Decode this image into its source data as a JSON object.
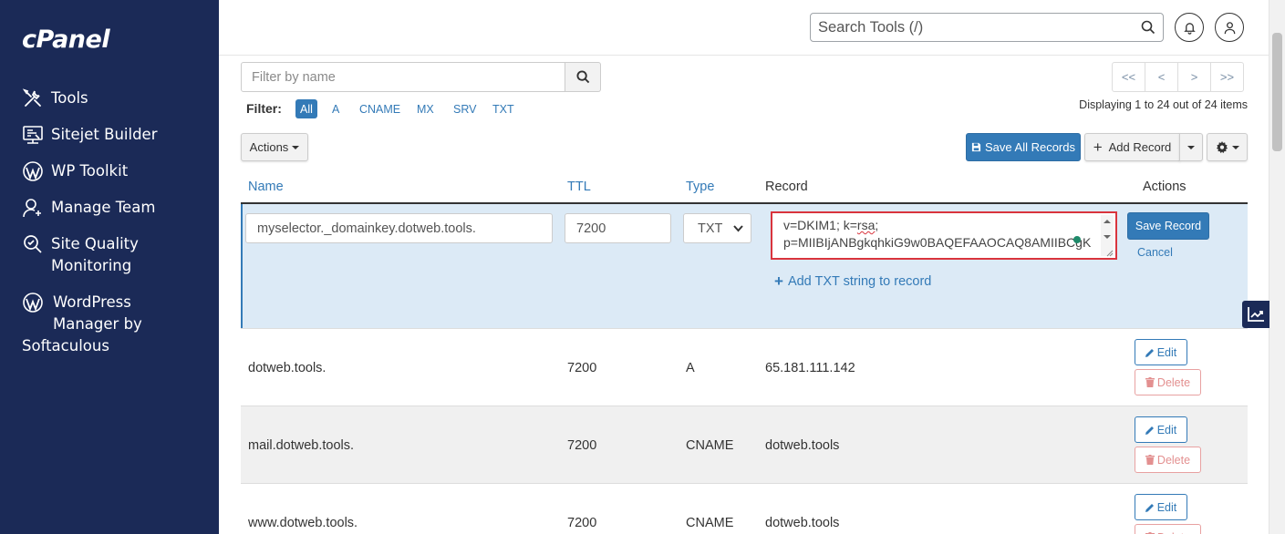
{
  "app": {
    "logo": "cPanel"
  },
  "sidebar": {
    "items": [
      {
        "label": "Tools",
        "icon": "tools-icon"
      },
      {
        "label": "Sitejet Builder",
        "icon": "sitejet-icon"
      },
      {
        "label": "WP Toolkit",
        "icon": "wordpress-icon"
      },
      {
        "label": "Manage Team",
        "icon": "user-plus-icon"
      },
      {
        "label_line1": "Site Quality",
        "label_line2": "Monitoring",
        "icon": "site-quality-icon"
      },
      {
        "label_line1": "WordPress",
        "label_line2": "Manager by",
        "label_line3": "Softaculous",
        "icon": "wordpress-icon"
      }
    ]
  },
  "topbar": {
    "search_placeholder": "Search Tools (/)"
  },
  "filter": {
    "placeholder": "Filter by name",
    "label": "Filter:",
    "types": [
      "All",
      "A",
      "CNAME",
      "MX",
      "SRV",
      "TXT"
    ],
    "active": "All"
  },
  "pagination": {
    "buttons": [
      "<<",
      "<",
      ">",
      ">>"
    ],
    "displaying": "Displaying 1 to 24 out of 24 items"
  },
  "toolbar": {
    "actions_label": "Actions",
    "save_all_label": "Save All Records",
    "add_record_label": "Add Record"
  },
  "table": {
    "headers": {
      "name": "Name",
      "ttl": "TTL",
      "type": "Type",
      "record": "Record",
      "actions": "Actions"
    },
    "edit_row": {
      "name": "myselector._domainkey.dotweb.tools.",
      "ttl": "7200",
      "type": "TXT",
      "record_line1_a": "v=DKIM1; k=",
      "record_line1_b": "rsa",
      "record_line1_c": ";",
      "record_line2": "p=MIIBIjANBgkqhkiG9w0BAQEFAAOCAQ8AMIIBCgK",
      "add_txt_label": "Add TXT string to record",
      "save_label": "Save Record",
      "cancel_label": "Cancel"
    },
    "rows": [
      {
        "name": "dotweb.tools.",
        "ttl": "7200",
        "type": "A",
        "record": "65.181.111.142"
      },
      {
        "name": "mail.dotweb.tools.",
        "ttl": "7200",
        "type": "CNAME",
        "record": "dotweb.tools"
      },
      {
        "name": "www.dotweb.tools.",
        "ttl": "7200",
        "type": "CNAME",
        "record": "dotweb.tools"
      }
    ],
    "edit_label": "Edit",
    "delete_label": "Delete"
  },
  "colors": {
    "sidebar": "#1b2a57",
    "primary": "#337ab7",
    "highlight_row": "#dceaf6",
    "danger_outline": "#d9343d"
  }
}
